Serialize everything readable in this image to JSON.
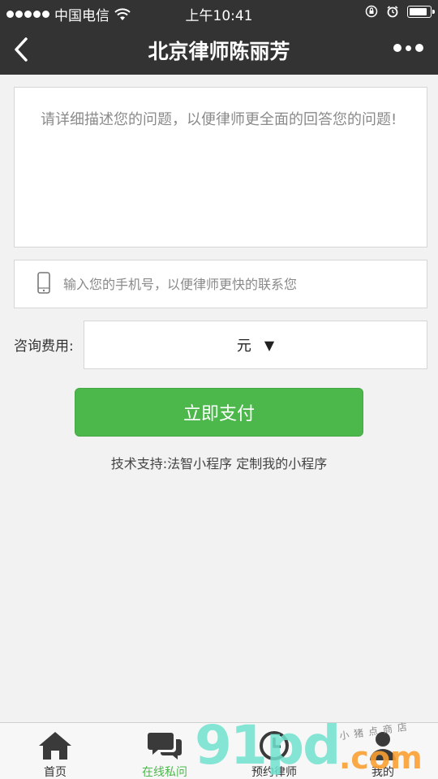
{
  "status_bar": {
    "carrier": "中国电信",
    "time": "上午10:41",
    "battery_level": 0.92,
    "icons": [
      "signal-dots-icon",
      "wifi-icon",
      "rotation-lock-icon",
      "alarm-icon",
      "battery-icon"
    ]
  },
  "nav": {
    "title": "北京律师陈丽芳",
    "back_icon": "chevron-left-icon",
    "more_icon": "more-dots-icon"
  },
  "form": {
    "question_placeholder": "请详细描述您的问题，以便律师更全面的回答您的问题!",
    "question_value": "",
    "phone_icon": "mobile-phone-icon",
    "phone_placeholder": "输入您的手机号，以便律师更快的联系您",
    "phone_value": "",
    "fee_label": "咨询费用:",
    "fee_value": "元",
    "fee_arrow": "▼",
    "pay_button": "立即支付"
  },
  "support": {
    "prefix": "技术支持:法智小程序",
    "link": "定制我的小程序"
  },
  "tabs": [
    {
      "label": "首页",
      "icon": "home-icon",
      "active": false
    },
    {
      "label": "在线私问",
      "icon": "chat-bubbles-icon",
      "active": true
    },
    {
      "label": "预约律师",
      "icon": "clock-icon",
      "active": false
    },
    {
      "label": "我的",
      "icon": "user-icon",
      "active": false
    }
  ],
  "watermark": {
    "main": "91pd",
    "domain": ".com",
    "small": "小猪点商店"
  },
  "colors": {
    "header_bg": "#333333",
    "accent_green": "#4cb84c",
    "page_bg": "#f2f2f2"
  }
}
